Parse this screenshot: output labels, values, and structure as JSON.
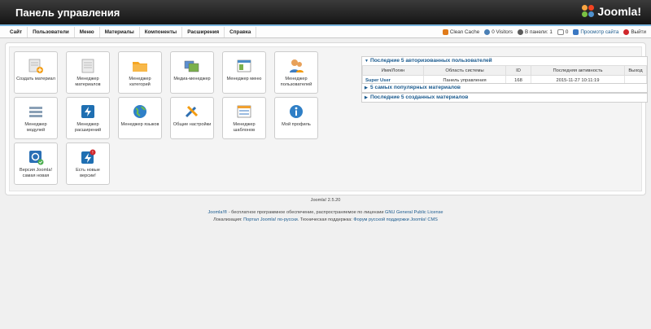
{
  "header": {
    "title": "Панель управления",
    "logo_text": "Joomla!"
  },
  "menu": [
    "Сайт",
    "Пользователи",
    "Меню",
    "Материалы",
    "Компоненты",
    "Расширения",
    "Справка"
  ],
  "status": {
    "clean_cache": "Clean Cache",
    "visitors": "0 Visitors",
    "in_panel": "В панели: 1",
    "messages": "0",
    "view_site": "Просмотр сайта",
    "logout": "Выйти"
  },
  "tiles": [
    {
      "label": "Создать материал",
      "icon": "add-article-icon"
    },
    {
      "label": "Менеджер материалов",
      "icon": "articles-icon"
    },
    {
      "label": "Менеджер категорий",
      "icon": "folder-icon"
    },
    {
      "label": "Медиа-менеджер",
      "icon": "media-icon"
    },
    {
      "label": "Менеджер меню",
      "icon": "menu-icon"
    },
    {
      "label": "Менеджер пользователей",
      "icon": "users-icon"
    },
    {
      "label": "Менеджер модулей",
      "icon": "modules-icon"
    },
    {
      "label": "Менеджер расширений",
      "icon": "extensions-icon"
    },
    {
      "label": "Менеджер языков",
      "icon": "globe-icon"
    },
    {
      "label": "Общие настройки",
      "icon": "tools-icon"
    },
    {
      "label": "Менеджер шаблонов",
      "icon": "templates-icon"
    },
    {
      "label": "Мой профиль",
      "icon": "info-icon"
    },
    {
      "label": "Версия Joomla! самая новая",
      "icon": "joomla-ok-icon"
    },
    {
      "label": "Есть новые версии!",
      "icon": "update-icon"
    }
  ],
  "panels": {
    "logged_users": {
      "title": "Последние 5 авторизованных пользователей",
      "headers": [
        "Имя/Логин",
        "Область системы",
        "ID",
        "Последняя активность",
        "Выход"
      ],
      "rows": [
        [
          "Super User",
          "Панель управления",
          "168",
          "2015-11-27 10:11:19",
          ""
        ]
      ]
    },
    "popular": {
      "title": "5 самых популярных материалов"
    },
    "latest": {
      "title": "Последние 5 созданных материалов"
    }
  },
  "footer": {
    "version": "Joomla! 2.5.20",
    "line1_a": "Joomla!®",
    "line1_b": " - бесплатное программное обеспечение, распространяемое по лицензии ",
    "line1_c": "GNU General Public License",
    "line2_a": "Локализация: ",
    "line2_b": "Портал Joomla! по-русски",
    "line2_c": ". Техническая поддержка: ",
    "line2_d": "Форум русской поддержки Joomla! CMS"
  }
}
